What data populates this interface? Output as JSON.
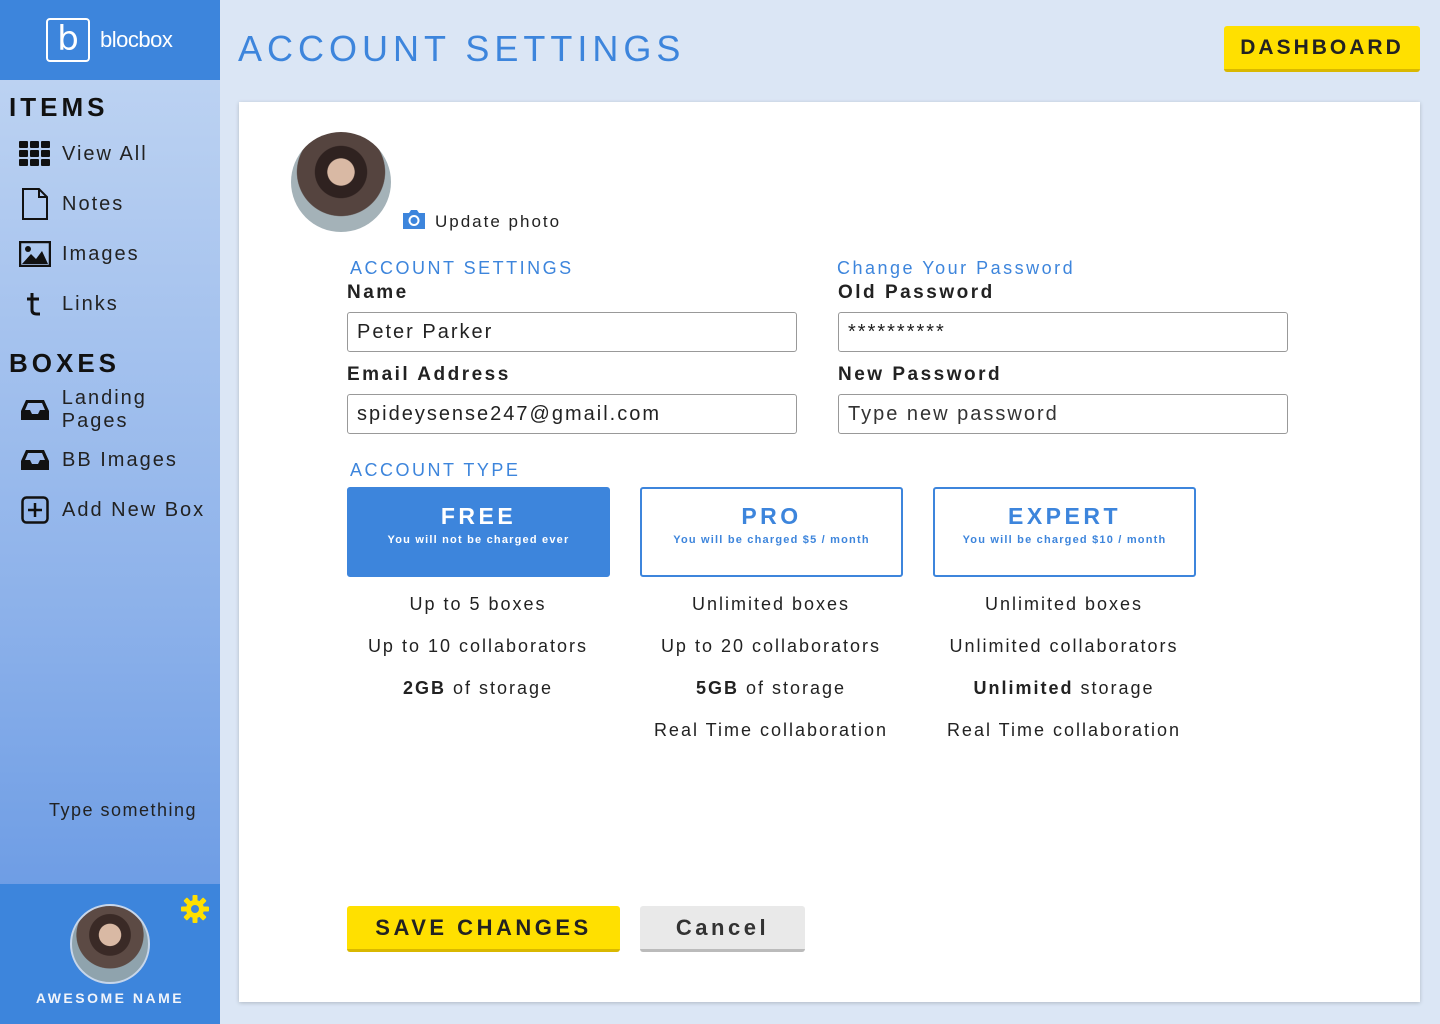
{
  "app": {
    "logo_letter": "b",
    "logo_text": "blocbox"
  },
  "sidebar": {
    "items_title": "ITEMS",
    "items": [
      {
        "label": "View All",
        "icon": "grid-icon"
      },
      {
        "label": "Notes",
        "icon": "document-icon"
      },
      {
        "label": "Images",
        "icon": "image-icon"
      },
      {
        "label": "Links",
        "icon": "links-t-icon"
      }
    ],
    "boxes_title": "BOXES",
    "boxes": [
      {
        "label": "Landing Pages",
        "icon": "inbox-icon"
      },
      {
        "label": "BB Images",
        "icon": "inbox-icon"
      },
      {
        "label": "Add New Box",
        "icon": "plus-box-icon"
      }
    ],
    "type_something": "Type something",
    "user_name": "AWESOME NAME"
  },
  "header": {
    "title": "ACCOUNT SETTINGS",
    "dashboard_label": "DASHBOARD"
  },
  "profile": {
    "update_photo_label": "Update photo"
  },
  "account": {
    "heading": "ACCOUNT SETTINGS",
    "name_label": "Name",
    "name_value": "Peter Parker",
    "email_label": "Email Address",
    "email_value": "spideysense247@gmail.com"
  },
  "password": {
    "heading": "Change Your Password",
    "old_label": "Old Password",
    "old_value": "**********",
    "new_label": "New Password",
    "new_placeholder": "Type new password"
  },
  "account_type": {
    "heading": "ACCOUNT TYPE",
    "selected": "FREE",
    "plans": [
      {
        "name": "FREE",
        "desc": "You will not be charged ever",
        "features": [
          {
            "pre": "Up to 5 boxes",
            "bold": "",
            "post": ""
          },
          {
            "pre": "Up to 10 collaborators",
            "bold": "",
            "post": ""
          },
          {
            "pre": "",
            "bold": "2GB",
            "post": " of storage"
          }
        ]
      },
      {
        "name": "PRO",
        "desc": "You will be charged $5 / month",
        "features": [
          {
            "pre": "Unlimited boxes",
            "bold": "",
            "post": ""
          },
          {
            "pre": "Up to 20 collaborators",
            "bold": "",
            "post": ""
          },
          {
            "pre": "",
            "bold": "5GB",
            "post": " of storage"
          },
          {
            "pre": "Real Time collaboration",
            "bold": "",
            "post": ""
          }
        ]
      },
      {
        "name": "EXPERT",
        "desc": "You will be charged $10 / month",
        "features": [
          {
            "pre": "Unlimited boxes",
            "bold": "",
            "post": ""
          },
          {
            "pre": "Unlimited collaborators",
            "bold": "",
            "post": ""
          },
          {
            "pre": "",
            "bold": "Unlimited",
            "post": " storage"
          },
          {
            "pre": "Real Time collaboration",
            "bold": "",
            "post": ""
          }
        ]
      }
    ]
  },
  "actions": {
    "save_label": "SAVE CHANGES",
    "cancel_label": "Cancel"
  },
  "colors": {
    "accent": "#3d85dc",
    "highlight": "#ffe000",
    "background": "#dbe6f5"
  }
}
